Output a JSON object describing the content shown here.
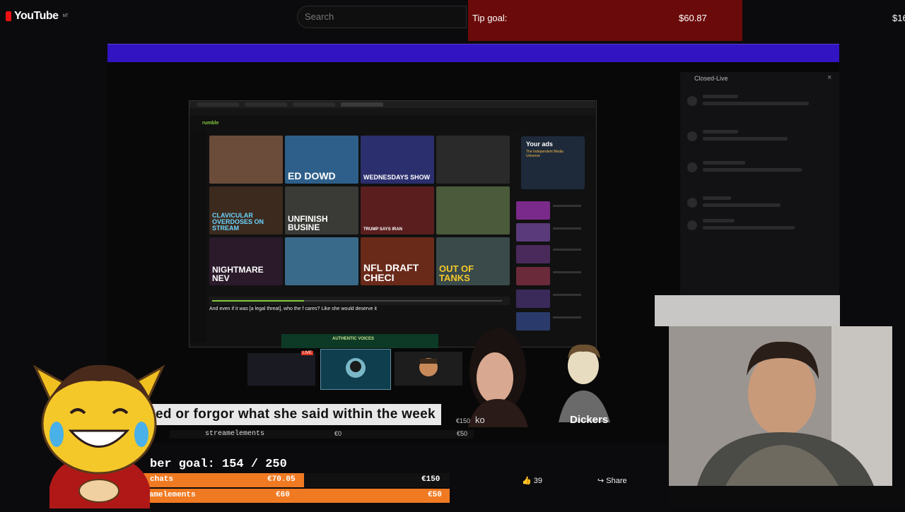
{
  "youtube": {
    "logo": "YouTube",
    "logo_suffix": "MT",
    "search_placeholder": "Search",
    "like_count": "39",
    "share_label": "Share"
  },
  "tip_goal": {
    "label": "Tip goal:",
    "amount": "$60.87",
    "right": "$16"
  },
  "closed_live": {
    "title": "Closed-Live",
    "close": "×"
  },
  "inner_browser": {
    "site": "rumble",
    "video_title": "And even if it was [a legal threat], who the f cares? Like she would deserve it",
    "ads_title": "Your ads",
    "ads_sub": "The Independent Media Universe",
    "thumbnails": [
      {
        "text": "",
        "bg": "#6b4b3a"
      },
      {
        "text": "ED DOWD",
        "bg": "#2e5f8a"
      },
      {
        "text": "WEDNESDAYS SHOW",
        "bg": "#2b2f6e"
      },
      {
        "text": "",
        "bg": "#2a2a2a"
      },
      {
        "text": "CLAVICULAR OVERDOSES ON STREAM",
        "bg": "#3c2a1e"
      },
      {
        "text": "UNFINISH BUSINE",
        "bg": "#3a3a36"
      },
      {
        "text": "TRUMP SAYS IRAN",
        "bg": "#5a1e1e"
      },
      {
        "text": "",
        "bg": "#4a5a3a"
      },
      {
        "text": "NIGHTMARE NEV",
        "bg": "#2a1a2a"
      },
      {
        "text": "",
        "bg": "#3a6a8a"
      },
      {
        "text": "NFL DRAFT CHECI",
        "bg": "#6a2a1a"
      },
      {
        "text": "OUT OF TANKS",
        "bg": "#3a4a4a"
      }
    ]
  },
  "banner": {
    "text": "AUTHENTIC VOICES",
    "live": "LIVE"
  },
  "caption": "ed or forgor what she said within the week",
  "streamelements": {
    "label": "streamelements",
    "val1": "€0",
    "val2": "€50",
    "val150": "€150",
    "ko": "ko"
  },
  "names": {
    "dickers": "Dickers"
  },
  "member_goal": {
    "label": "ber goal: 154 / 250",
    "row1_label": "chats",
    "row1_mid": "€70.05",
    "row1_right": "€150",
    "row2_label": "eamelements",
    "row2_mid": "€60",
    "row2_right": "€50"
  },
  "colors": {
    "purple_bar": "#3214c2",
    "tip_goal_bg": "#6b0a0a",
    "goal_bar": "#f07a22",
    "rumble_green": "#85c742"
  }
}
